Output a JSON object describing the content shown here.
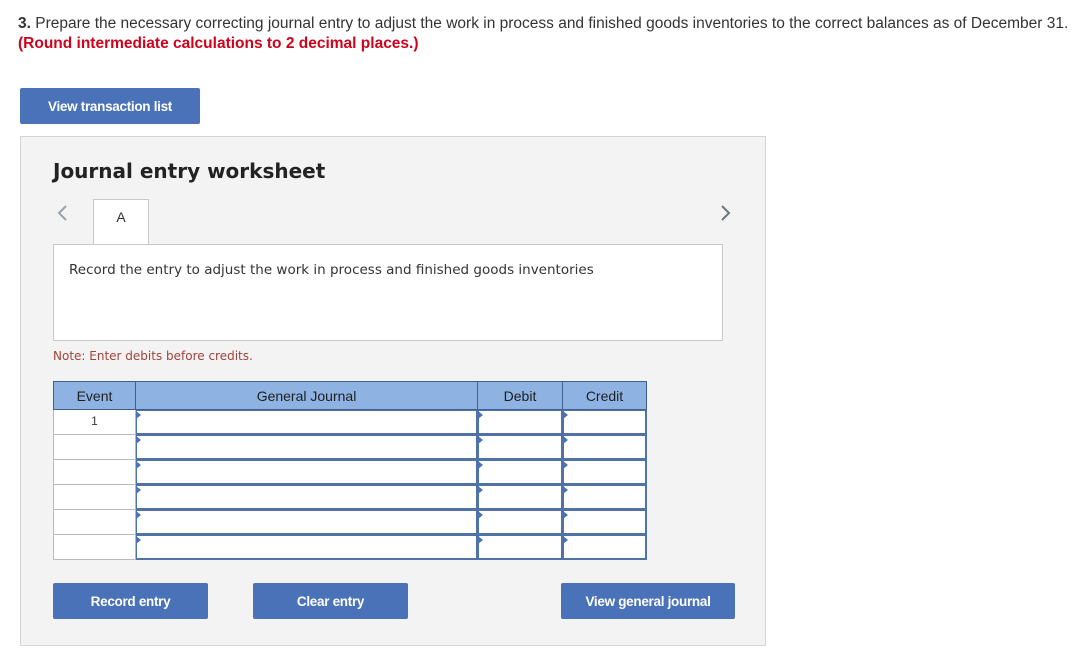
{
  "question": {
    "number": "3.",
    "text": " Prepare the necessary correcting journal entry to adjust the work in process and finished goods inventories to the correct balances as of December 31. ",
    "hint": "(Round intermediate calculations to 2 decimal places.)"
  },
  "view_transaction_label": "View transaction list",
  "worksheet": {
    "title": "Journal entry worksheet",
    "tab_label": "A",
    "description": "Record the entry to adjust the work in process and finished goods inventories",
    "note": "Note: Enter debits before credits.",
    "table": {
      "headers": {
        "event": "Event",
        "journal": "General Journal",
        "debit": "Debit",
        "credit": "Credit"
      },
      "rows": [
        {
          "event": "1",
          "account": "",
          "debit": "",
          "credit": ""
        },
        {
          "event": "",
          "account": "",
          "debit": "",
          "credit": ""
        },
        {
          "event": "",
          "account": "",
          "debit": "",
          "credit": ""
        },
        {
          "event": "",
          "account": "",
          "debit": "",
          "credit": ""
        },
        {
          "event": "",
          "account": "",
          "debit": "",
          "credit": ""
        },
        {
          "event": "",
          "account": "",
          "debit": "",
          "credit": ""
        }
      ]
    },
    "buttons": {
      "record": "Record entry",
      "clear": "Clear entry",
      "view_journal": "View general journal"
    }
  },
  "icons": {
    "prev": "chevron-left-icon",
    "next": "chevron-right-icon"
  },
  "colors": {
    "button": "#4a72b8",
    "header": "#8eb3e2",
    "hint": "#d0021b"
  }
}
